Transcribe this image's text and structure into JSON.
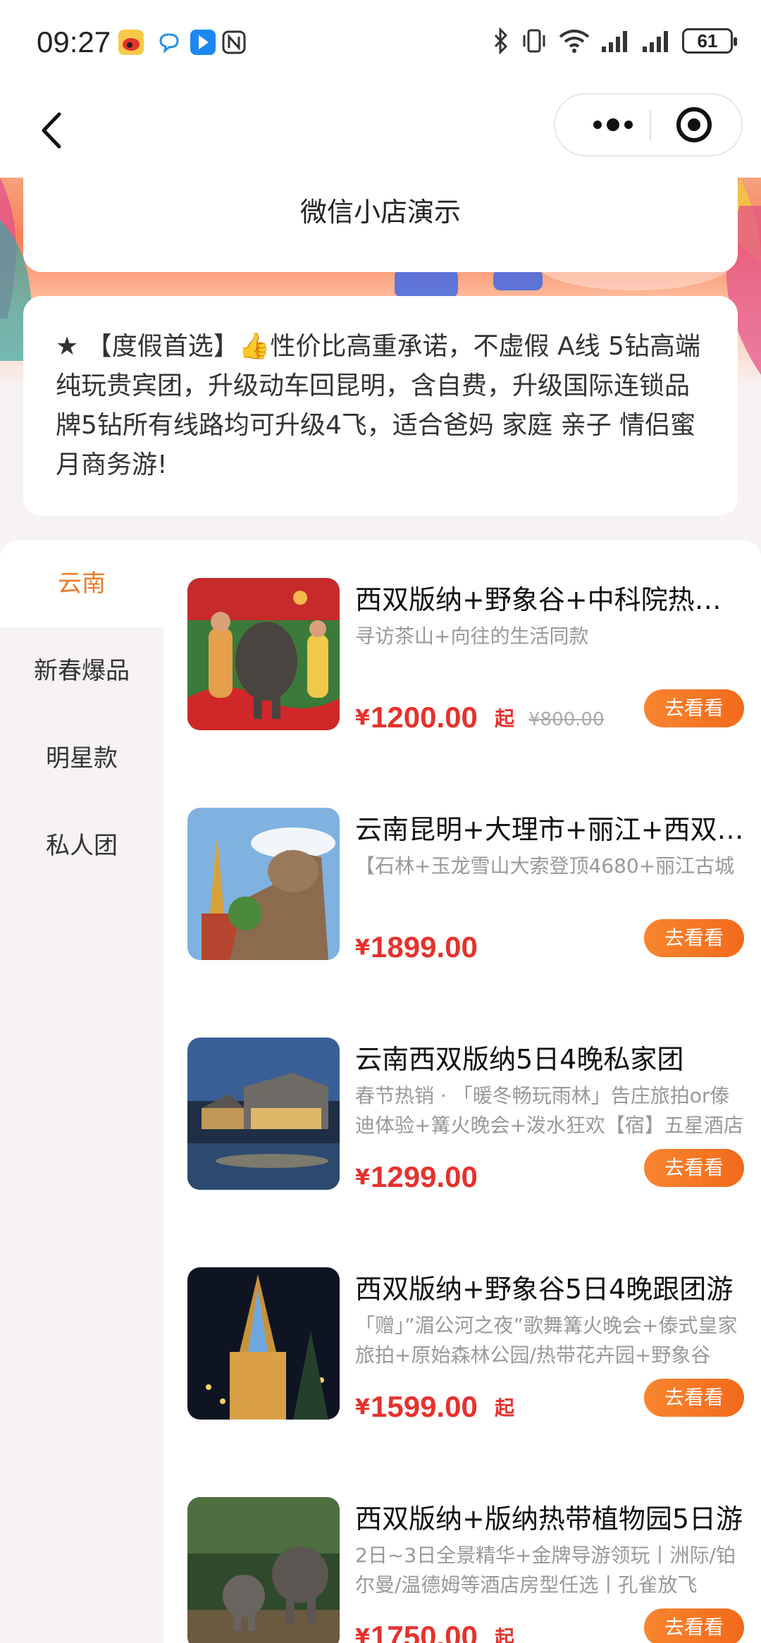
{
  "status_bar": {
    "time": "09:27",
    "battery": "61",
    "icons": [
      "weibo-icon",
      "chat-bubble-icon",
      "arrow-app-icon",
      "nfc-icon",
      "bluetooth-icon",
      "vibrate-icon",
      "wifi-icon",
      "signal-icon",
      "signal-icon"
    ]
  },
  "nav": {
    "back_icon": "chevron-left-icon",
    "more_icon": "more-dots-icon",
    "close_icon": "target-circle-icon"
  },
  "shop": {
    "name": "微信小店演示",
    "description": "★ 【度假首选】👍性价比高重承诺，不虚假 A线 5钻高端纯玩贵宾团，升级动车回昆明，含自费，升级国际连锁品牌5钻所有线路均可升级4飞，适合爸妈 家庭 亲子 情侣蜜月商务游!"
  },
  "categories": [
    {
      "label": "云南",
      "active": true
    },
    {
      "label": "新春爆品",
      "active": false
    },
    {
      "label": "明星款",
      "active": false
    },
    {
      "label": "私人团",
      "active": false
    }
  ],
  "products": [
    {
      "title": "西双版纳+野象谷+中科院热带植物园",
      "subtitle": "寻访茶山+向往的生活同款",
      "currency": "¥",
      "price": "1200.00",
      "from": "起",
      "original_price": "¥800.00",
      "button": "去看看"
    },
    {
      "title": "云南昆明+大理市+丽江+西双版纳",
      "subtitle": "【石林+玉龙雪山大索登顶4680+丽江古城",
      "currency": "¥",
      "price": "1899.00",
      "from": "",
      "original_price": "",
      "button": "去看看"
    },
    {
      "title": "云南西双版纳5日4晚私家团",
      "subtitle": "春节热销 · 「暖冬畅玩雨林」告庄旅拍or傣迪体验+篝火晚会+泼水狂欢【宿】五星酒店",
      "currency": "¥",
      "price": "1299.00",
      "from": "",
      "original_price": "",
      "button": "去看看"
    },
    {
      "title": "西双版纳+野象谷5日4晚跟团游",
      "subtitle": "「赠」”湄公河之夜”歌舞篝火晚会+傣式皇家旅拍+原始森林公园/热带花卉园+野象谷",
      "currency": "¥",
      "price": "1599.00",
      "from": "起",
      "original_price": "",
      "button": "去看看"
    },
    {
      "title": "西双版纳+版纳热带植物园5日游",
      "subtitle": "2日~3日全景精华+金牌导游领玩丨洲际/铂尔曼/温德姆等酒店房型任选丨孔雀放飞",
      "currency": "¥",
      "price": "1750.00",
      "from": "起",
      "original_price": "",
      "button": "去看看"
    }
  ]
}
